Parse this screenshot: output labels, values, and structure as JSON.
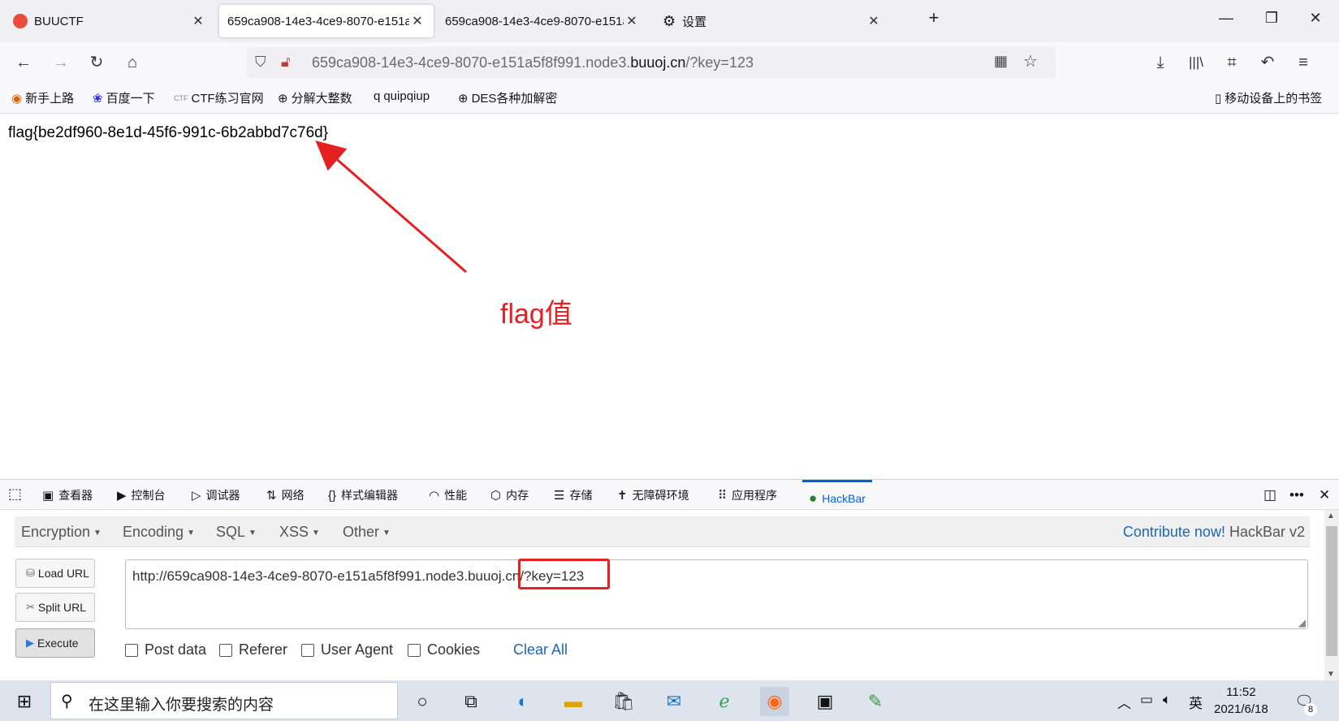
{
  "browser": {
    "tabs": [
      {
        "label": "BUUCTF",
        "active": false
      },
      {
        "label": "659ca908-14e3-4ce9-8070-e151a",
        "active": true
      },
      {
        "label": "659ca908-14e3-4ce9-8070-e151a",
        "active": false
      },
      {
        "label": "设置",
        "active": false
      }
    ],
    "new_tab": "+",
    "window": {
      "minimize": "—",
      "restore": "❐",
      "close": "✕"
    },
    "url_prefix": "659ca908-14e3-4ce9-8070-e151a5f8f991.node3.",
    "url_host": "buuoj.cn",
    "url_suffix": "/?key=123",
    "bookmarks": [
      "新手上路",
      "百度一下",
      "CTF练习官网",
      "分解大整数",
      "quipqiup",
      "DES各种加解密"
    ],
    "mobile_bookmarks": "移动设备上的书签"
  },
  "page": {
    "flag": "flag{be2df960-8e1d-45f6-991c-6b2abbd7c76d}",
    "annotation": "flag值"
  },
  "devtools": {
    "tabs": [
      "查看器",
      "控制台",
      "调试器",
      "网络",
      "样式编辑器",
      "性能",
      "内存",
      "存储",
      "无障碍环境",
      "应用程序",
      "HackBar"
    ],
    "active_tab": "HackBar"
  },
  "hackbar": {
    "menu": [
      "Encryption",
      "Encoding",
      "SQL",
      "XSS",
      "Other"
    ],
    "contribute_link": "Contribute now!",
    "contribute_rest": " HackBar v2",
    "load_url": "Load URL",
    "split_url": "Split URL",
    "execute": "Execute",
    "url_value": "http://659ca908-14e3-4ce9-8070-e151a5f8f991.node3.buuoj.cn/?key=123",
    "checkboxes": [
      "Post data",
      "Referer",
      "User Agent",
      "Cookies"
    ],
    "clear_all": "Clear All"
  },
  "taskbar": {
    "search_placeholder": "在这里输入你要搜索的内容",
    "ime": "英",
    "time": "11:52",
    "date": "2021/6/18",
    "notifications": "8"
  },
  "colors": {
    "accent": "#0060df",
    "annotation_red": "#e52020",
    "hackbar_link": "#1f67b8"
  }
}
